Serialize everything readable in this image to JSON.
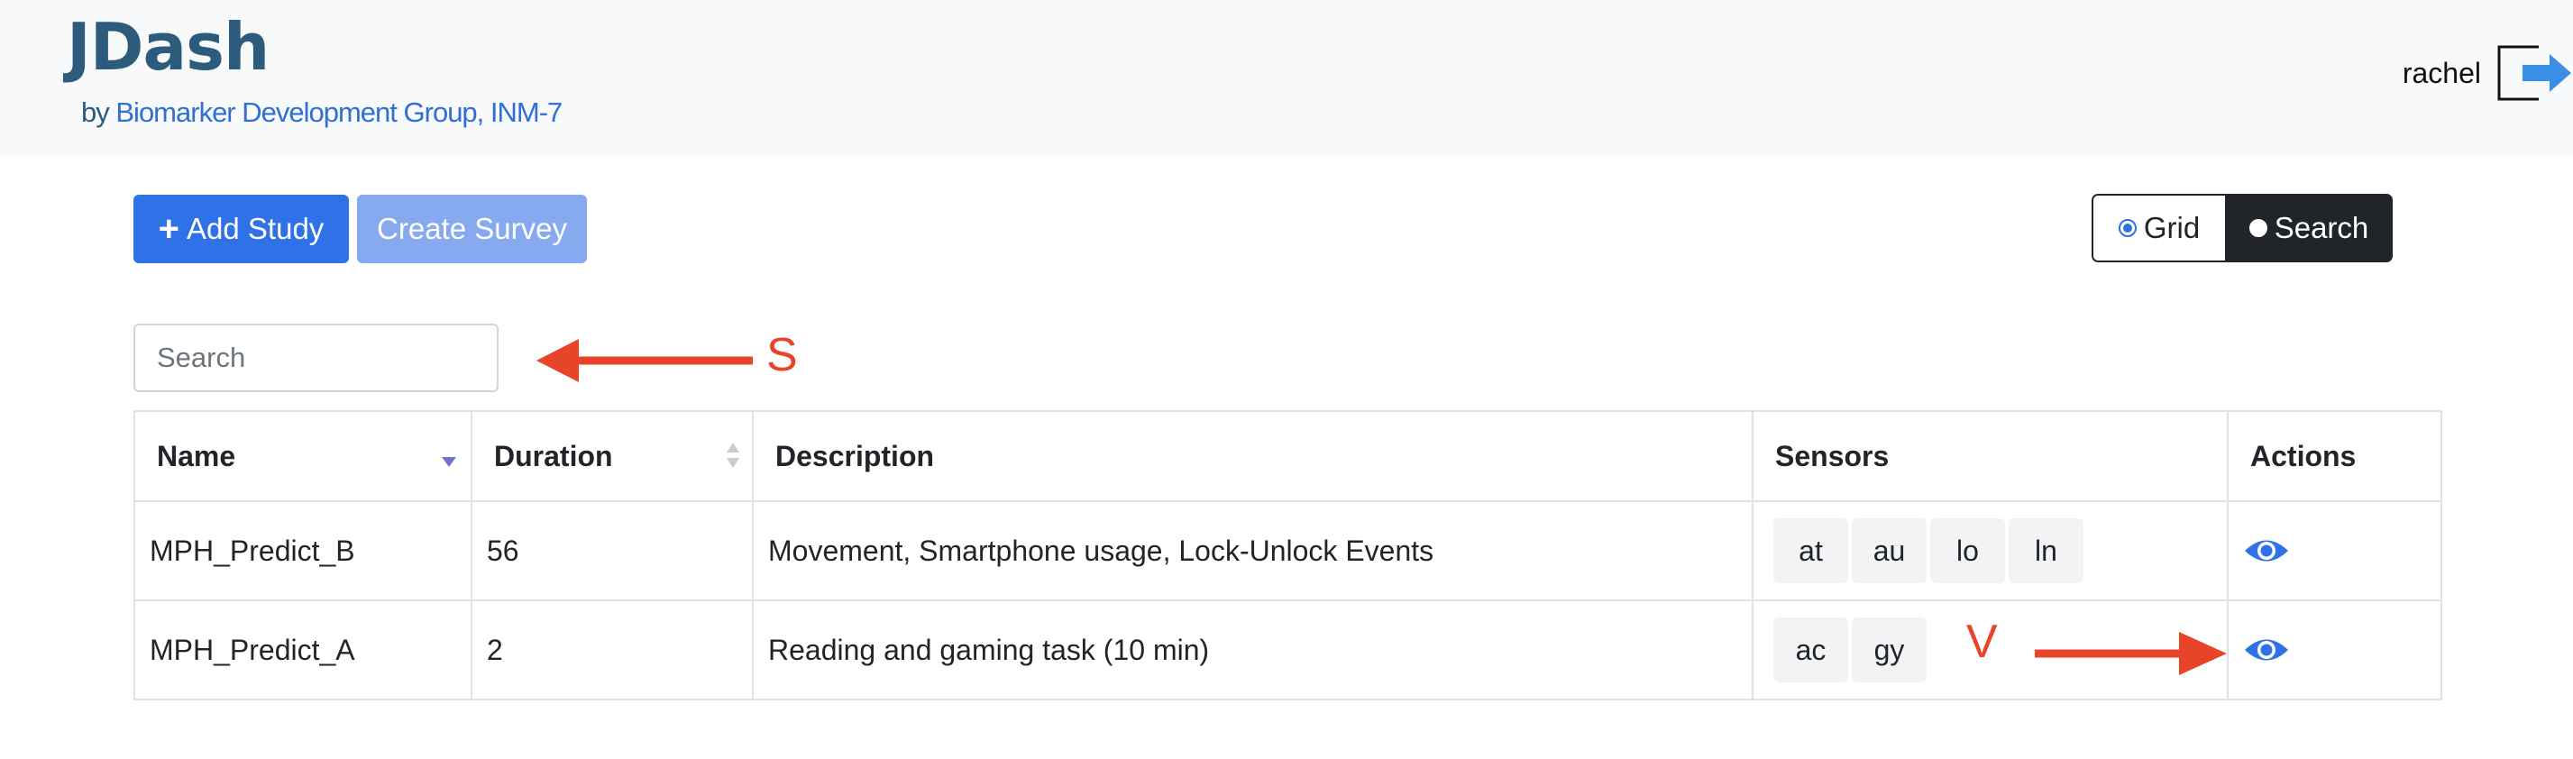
{
  "header": {
    "brand": "JDash",
    "by": "by",
    "org_link": "Biomarker Development Group, INM-7",
    "user": "rachel",
    "logout_icon": "logout-icon"
  },
  "toolbar": {
    "add_label": "Add Study",
    "survey_label": "Create Survey",
    "view_toggle": {
      "grid": "Grid",
      "search": "Search",
      "selected": "Grid"
    }
  },
  "search": {
    "placeholder": "Search",
    "value": ""
  },
  "annotations": {
    "search_marker": "S",
    "view_marker": "V",
    "color": "#e8442a"
  },
  "table": {
    "headers": [
      "Name",
      "Duration",
      "Description",
      "Sensors",
      "Actions"
    ],
    "sort": {
      "name": "descending",
      "duration": "unsorted"
    },
    "rows": [
      {
        "name": "MPH_Predict_B",
        "duration": "56",
        "description": "Movement, Smartphone usage, Lock-Unlock Events",
        "sensors": [
          "at",
          "au",
          "lo",
          "ln"
        ],
        "action_icon": "eye-icon"
      },
      {
        "name": "MPH_Predict_A",
        "duration": "2",
        "description": "Reading and gaming task (10 min)",
        "sensors": [
          "ac",
          "gy"
        ],
        "action_icon": "eye-icon"
      }
    ]
  },
  "colors": {
    "primary": "#2f72e8",
    "brand": "#2c5b7c",
    "link": "#2f6fd6",
    "dark": "#212529"
  }
}
